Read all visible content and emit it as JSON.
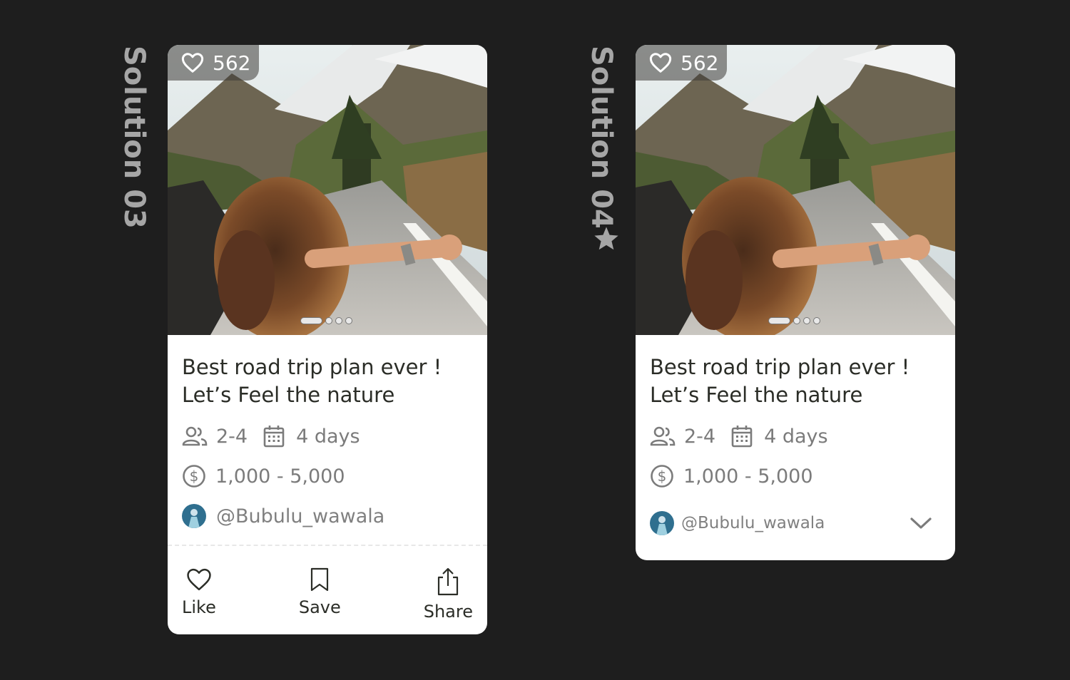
{
  "cards": [
    {
      "label": "Solution 03",
      "likes": "562",
      "title_line1": "Best road trip plan ever !",
      "title_line2": "Let’s Feel the nature",
      "people": "2-4",
      "duration": "4 days",
      "price": "1,000 -  5,000",
      "author": "@Bubulu_wawala",
      "actions": {
        "like": "Like",
        "save": "Save",
        "share": "Share"
      }
    },
    {
      "label": "Solution 04",
      "likes": "562",
      "title_line1": "Best road trip plan ever !",
      "title_line2": "Let’s Feel the nature",
      "people": "2-4",
      "duration": "4 days",
      "price": "1,000 -  5,000",
      "author": "@Bubulu_wawala"
    }
  ],
  "icons": {
    "heart": "heart-icon",
    "people": "people-icon",
    "calendar": "calendar-icon",
    "dollar": "dollar-circle-icon",
    "bookmark": "bookmark-icon",
    "share": "share-icon",
    "chevron": "chevron-down-icon",
    "star": "star-icon"
  },
  "colors": {
    "background": "#1e1e1e",
    "card": "#ffffff",
    "title_text": "#2b2d27",
    "meta_text": "#7b7b7b",
    "label_text": "#a6a6a6"
  },
  "carousel": {
    "total": 4,
    "active": 1
  }
}
